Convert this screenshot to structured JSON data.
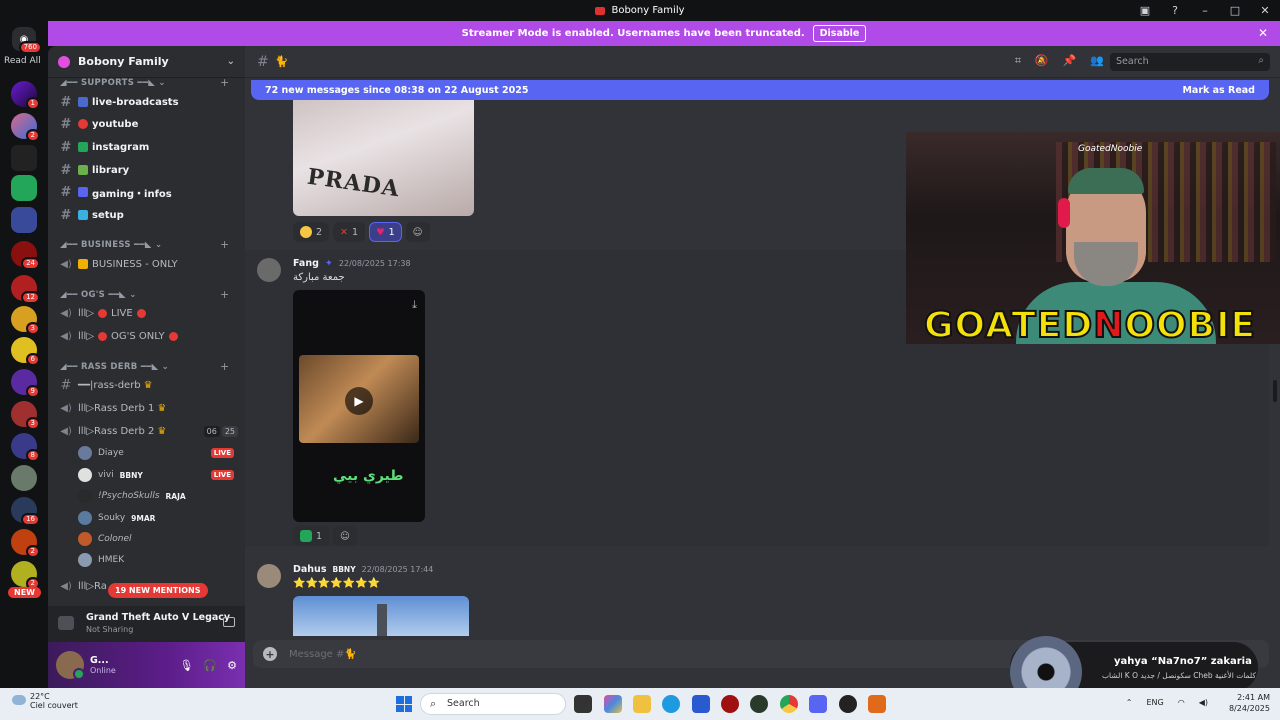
{
  "window": {
    "title": "Bobony Family"
  },
  "streamer_banner": {
    "text": "Streamer Mode is enabled. Usernames have been truncated.",
    "button": "Disable"
  },
  "rail": {
    "read_all": "Read All",
    "home_badge": "760",
    "new_label": "NEW",
    "badges": [
      "1",
      "2",
      "24",
      "12",
      "3",
      "6",
      "9",
      "3",
      "8",
      "16",
      "2",
      "2"
    ]
  },
  "server": {
    "name": "Bobony Family"
  },
  "categories": [
    {
      "label": "SUPPORTS"
    },
    {
      "label": "BUSINESS"
    },
    {
      "label": "OG'S"
    },
    {
      "label": "RASS DERB"
    }
  ],
  "channels": {
    "supports": [
      "live-broadcasts",
      "youtube",
      "instagram",
      "library",
      "gaming・infos",
      "setup"
    ],
    "business": [
      "BUSINESS - ONLY"
    ],
    "ogs": [
      "LIVE",
      "OG'S ONLY"
    ],
    "rass": [
      "rass-derb",
      "Rass Derb 1",
      "Rass Derb 2",
      "Ra"
    ]
  },
  "voice_counts": {
    "a": "06",
    "b": "25"
  },
  "voice_users": [
    {
      "name": "Diaye",
      "tag": "",
      "live": "LIVE"
    },
    {
      "name": "vivi",
      "tag": "BBNY",
      "live": "LIVE"
    },
    {
      "name": "!PsychoSkulls",
      "tag": "RAJA",
      "live": ""
    },
    {
      "name": "Souky",
      "tag": "9MAR",
      "live": ""
    },
    {
      "name": "Colonel",
      "tag": "",
      "live": ""
    },
    {
      "name": "HMEK",
      "tag": "",
      "live": ""
    }
  ],
  "mentions_pill": "19 NEW MENTIONS",
  "activity": {
    "title": "Grand Theft Auto V Legacy",
    "status": "Not Sharing"
  },
  "user_panel": {
    "name": "G...",
    "status": "Online"
  },
  "channel_header": {
    "name": "🐈",
    "search_placeholder": "Search"
  },
  "new_messages_bar": {
    "text": "72 new messages since 08:38 on 22 August 2025",
    "action": "Mark as Read"
  },
  "image1": {
    "print": "PRADA"
  },
  "reactions1": [
    {
      "count": "2",
      "color": "#f7c744"
    },
    {
      "count": "1",
      "color": "#e53935"
    },
    {
      "count": "1",
      "color": "#e5246a"
    }
  ],
  "messages": [
    {
      "author": "Fang",
      "timestamp": "22/08/2025 17:38",
      "text": "جمعة مباركة",
      "video_caption": "طيري بيي"
    },
    {
      "author": "Dahus",
      "tag": "BBNY",
      "timestamp": "22/08/2025 17:44",
      "text": "⭐⭐⭐⭐⭐⭐⭐"
    }
  ],
  "reactions2": [
    {
      "count": "1",
      "color": "#23a55a"
    }
  ],
  "composer": {
    "placeholder": "Message #🐈"
  },
  "stream_overlay": {
    "tag": "GoatedNoobie",
    "logo_a": "GOATED",
    "logo_b": "N",
    "logo_c": "OOBIE"
  },
  "now_playing": {
    "title": "yahya “Na7no7” zakaria",
    "subtitle": "الشاب K O سكونصل / جديد Cheb كلمات الأغنية"
  },
  "taskbar": {
    "weather_temp": "22°C",
    "weather_desc": "Ciel couvert",
    "search": "Search",
    "lang": "ENG",
    "time": "2:41 AM",
    "date": "8/24/2025"
  }
}
